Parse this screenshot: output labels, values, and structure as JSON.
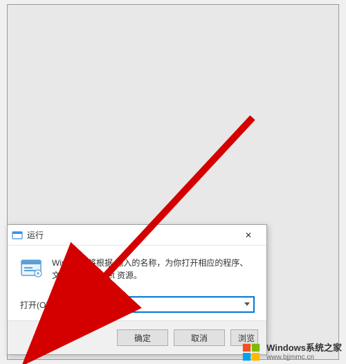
{
  "dialog": {
    "title": "运行",
    "description_line1": "Windows 将根据 输入的名称，为你打开相应的程序、",
    "description_line2": "文件夹、文     ernet 资源。",
    "open_label": "打开(O):",
    "input_value": "",
    "buttons": {
      "ok": "确定",
      "cancel": "取消",
      "browse": "浏览"
    },
    "close_symbol": "✕"
  },
  "watermark": {
    "text": "Windows系统之家",
    "url": "www.bjjmmc.cn"
  }
}
